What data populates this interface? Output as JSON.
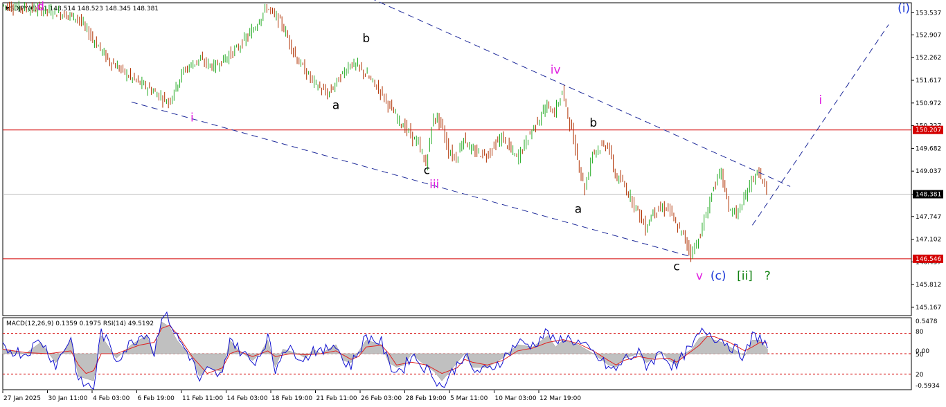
{
  "header": {
    "symbol_line": "USDJPY(€),H1  148.514 148.523 148.345 148.381",
    "indicator_line": "MACD(12,26,9) 0.1359 0.1975  RSI(14) 49.5192"
  },
  "chart_data": {
    "type": "line",
    "title": "USDJPY(€),H1",
    "ohlc_last": {
      "open": 148.514,
      "high": 148.523,
      "low": 148.345,
      "close": 148.381
    },
    "y_ticks": [
      "153.537",
      "152.907",
      "152.262",
      "151.617",
      "150.972",
      "150.327",
      "149.682",
      "149.037",
      "148.381",
      "147.747",
      "147.102",
      "146.457",
      "145.812",
      "145.167"
    ],
    "ylim": [
      144.95,
      153.8
    ],
    "x_ticks": [
      "27 Jan 2025",
      "30 Jan 11:00",
      "4 Feb 03:00",
      "6 Feb 19:00",
      "11 Feb 11:00",
      "14 Feb 03:00",
      "18 Feb 19:00",
      "21 Feb 11:00",
      "26 Feb 03:00",
      "28 Feb 19:00",
      "5 Mar 11:00",
      "10 Mar 03:00",
      "12 Mar 19:00"
    ],
    "price_path": [
      [
        0,
        153.75
      ],
      [
        6,
        153.6
      ],
      [
        10,
        153.4
      ],
      [
        14,
        152.2
      ],
      [
        17,
        151.7
      ],
      [
        20,
        151.3
      ],
      [
        22,
        151.0
      ],
      [
        24,
        151.9
      ],
      [
        26,
        152.2
      ],
      [
        28,
        152.0
      ],
      [
        31,
        152.5
      ],
      [
        33,
        153.0
      ],
      [
        35,
        153.7
      ],
      [
        37,
        153.2
      ],
      [
        39,
        152.2
      ],
      [
        41,
        151.6
      ],
      [
        43,
        151.2
      ],
      [
        44,
        151.5
      ],
      [
        46,
        152.1
      ],
      [
        47,
        152.0
      ],
      [
        48,
        151.8
      ],
      [
        50,
        151.3
      ],
      [
        52,
        150.6
      ],
      [
        55,
        149.8
      ],
      [
        56,
        149.2
      ],
      [
        57,
        150.6
      ],
      [
        58,
        150.4
      ],
      [
        59,
        149.6
      ],
      [
        60,
        149.4
      ],
      [
        61,
        150.0
      ],
      [
        62,
        149.6
      ],
      [
        64,
        149.5
      ],
      [
        66,
        150.0
      ],
      [
        68,
        149.4
      ],
      [
        70,
        150.2
      ],
      [
        72,
        150.9
      ],
      [
        73,
        150.7
      ],
      [
        74,
        151.3
      ],
      [
        75,
        150.4
      ],
      [
        76,
        149.4
      ],
      [
        77,
        148.5
      ],
      [
        78,
        149.6
      ],
      [
        80,
        149.8
      ],
      [
        81,
        148.9
      ],
      [
        82,
        148.7
      ],
      [
        84,
        147.9
      ],
      [
        85,
        147.4
      ],
      [
        86,
        147.9
      ],
      [
        88,
        148.0
      ],
      [
        89,
        147.5
      ],
      [
        90,
        147.2
      ],
      [
        91,
        146.7
      ],
      [
        92,
        147.1
      ],
      [
        93,
        147.8
      ],
      [
        94,
        148.6
      ],
      [
        95,
        149.0
      ],
      [
        96,
        148.0
      ],
      [
        97,
        147.8
      ],
      [
        98,
        148.2
      ],
      [
        99,
        148.8
      ],
      [
        100,
        149.0
      ],
      [
        101,
        148.4
      ]
    ],
    "macd_line": [
      [
        0,
        0.1
      ],
      [
        3,
        0.0
      ],
      [
        5,
        0.25
      ],
      [
        7,
        -0.2
      ],
      [
        9,
        0.3
      ],
      [
        10,
        -0.5
      ],
      [
        12,
        -0.6
      ],
      [
        13,
        0.4
      ],
      [
        15,
        -0.1
      ],
      [
        17,
        0.2
      ],
      [
        19,
        0.4
      ],
      [
        20,
        0.0
      ],
      [
        21,
        0.7
      ],
      [
        22,
        0.6
      ],
      [
        23,
        0.3
      ],
      [
        24,
        0.1
      ],
      [
        25,
        -0.1
      ],
      [
        26,
        -0.5
      ],
      [
        27,
        -0.3
      ],
      [
        29,
        -0.4
      ],
      [
        30,
        0.3
      ],
      [
        31,
        0.1
      ],
      [
        33,
        -0.15
      ],
      [
        34,
        0.0
      ],
      [
        35,
        0.3
      ],
      [
        36,
        -0.3
      ],
      [
        37,
        0.1
      ],
      [
        39,
        0.0
      ],
      [
        40,
        -0.1
      ],
      [
        41,
        0.1
      ],
      [
        42,
        0.0
      ],
      [
        44,
        0.2
      ],
      [
        45,
        -0.15
      ],
      [
        46,
        -0.2
      ],
      [
        47,
        0.05
      ],
      [
        48,
        0.3
      ],
      [
        50,
        0.2
      ],
      [
        51,
        -0.2
      ],
      [
        52,
        -0.3
      ],
      [
        53,
        -0.25
      ],
      [
        54,
        0.0
      ],
      [
        55,
        -0.15
      ],
      [
        57,
        -0.4
      ],
      [
        58,
        -0.6
      ],
      [
        60,
        -0.2
      ],
      [
        61,
        0.0
      ],
      [
        62,
        -0.3
      ],
      [
        64,
        -0.3
      ],
      [
        66,
        -0.1
      ],
      [
        68,
        0.2
      ],
      [
        70,
        0.15
      ],
      [
        72,
        0.4
      ],
      [
        73,
        0.15
      ],
      [
        74,
        0.3
      ],
      [
        76,
        0.2
      ],
      [
        77,
        0.1
      ],
      [
        78,
        0.0
      ],
      [
        80,
        -0.25
      ],
      [
        81,
        -0.3
      ],
      [
        82,
        -0.1
      ],
      [
        84,
        0.0
      ],
      [
        85,
        -0.2
      ],
      [
        86,
        -0.1
      ],
      [
        87,
        0.05
      ],
      [
        88,
        -0.15
      ],
      [
        89,
        -0.25
      ],
      [
        90,
        0.0
      ],
      [
        91,
        0.1
      ],
      [
        92,
        0.35
      ],
      [
        93,
        0.4
      ],
      [
        94,
        0.3
      ],
      [
        95,
        0.25
      ],
      [
        96,
        0.15
      ],
      [
        97,
        0.05
      ],
      [
        98,
        -0.05
      ],
      [
        99,
        0.3
      ],
      [
        100,
        0.3
      ],
      [
        101,
        0.1
      ]
    ],
    "signal_line": [
      [
        0,
        0.08
      ],
      [
        3,
        0.02
      ],
      [
        6,
        0.0
      ],
      [
        9,
        0.05
      ],
      [
        10,
        -0.2
      ],
      [
        11,
        -0.35
      ],
      [
        12,
        -0.3
      ],
      [
        13,
        0.0
      ],
      [
        15,
        0.0
      ],
      [
        18,
        0.15
      ],
      [
        20,
        0.2
      ],
      [
        21,
        0.45
      ],
      [
        22,
        0.5
      ],
      [
        23,
        0.35
      ],
      [
        24,
        0.15
      ],
      [
        25,
        -0.05
      ],
      [
        27,
        -0.35
      ],
      [
        29,
        -0.25
      ],
      [
        30,
        0.0
      ],
      [
        31,
        0.05
      ],
      [
        33,
        -0.05
      ],
      [
        35,
        0.05
      ],
      [
        36,
        -0.05
      ],
      [
        38,
        0.0
      ],
      [
        40,
        -0.02
      ],
      [
        42,
        0.0
      ],
      [
        44,
        0.05
      ],
      [
        46,
        -0.1
      ],
      [
        47,
        -0.05
      ],
      [
        48,
        0.12
      ],
      [
        50,
        0.15
      ],
      [
        51,
        0.0
      ],
      [
        52,
        -0.2
      ],
      [
        54,
        -0.15
      ],
      [
        56,
        -0.2
      ],
      [
        58,
        -0.35
      ],
      [
        60,
        -0.25
      ],
      [
        61,
        -0.1
      ],
      [
        62,
        -0.15
      ],
      [
        64,
        -0.2
      ],
      [
        66,
        -0.12
      ],
      [
        68,
        0.05
      ],
      [
        70,
        0.1
      ],
      [
        72,
        0.2
      ],
      [
        74,
        0.25
      ],
      [
        76,
        0.18
      ],
      [
        78,
        0.05
      ],
      [
        80,
        -0.12
      ],
      [
        81,
        -0.2
      ],
      [
        82,
        -0.12
      ],
      [
        84,
        -0.05
      ],
      [
        86,
        -0.1
      ],
      [
        88,
        -0.08
      ],
      [
        89,
        -0.15
      ],
      [
        90,
        -0.05
      ],
      [
        92,
        0.15
      ],
      [
        93,
        0.3
      ],
      [
        94,
        0.3
      ],
      [
        96,
        0.2
      ],
      [
        98,
        0.05
      ],
      [
        99,
        0.12
      ],
      [
        100,
        0.2
      ],
      [
        101,
        0.19
      ]
    ],
    "sub_ticks": [
      "0.5478",
      "80",
      "0.00",
      "50",
      "20",
      "-0.5934"
    ],
    "hlines": [
      {
        "label": "150.207",
        "price": 150.207,
        "color": "#d40000"
      },
      {
        "label": "146.546",
        "price": 146.546,
        "color": "#d40000"
      },
      {
        "label": "148.381",
        "price": 148.381,
        "color": "#bbbbbb"
      }
    ],
    "channel_lines": [
      {
        "from": [
          17,
          151.0
        ],
        "to": [
          91,
          146.6
        ]
      },
      {
        "from": [
          46,
          154.2
        ],
        "to": [
          104,
          148.6
        ]
      }
    ],
    "projection_line": {
      "from": [
        99,
        147.5
      ],
      "to": [
        117,
        153.2
      ]
    },
    "annotations": [
      {
        "text": "d",
        "x": 5,
        "y": 153.6,
        "color": "#e020e0"
      },
      {
        "text": "b",
        "x": 48,
        "y": 152.7,
        "color": "#000000"
      },
      {
        "text": "a",
        "x": 44,
        "y": 150.8,
        "color": "#000000"
      },
      {
        "text": "i",
        "x": 25,
        "y": 150.45,
        "color": "#e020e0"
      },
      {
        "text": "iv",
        "x": 73,
        "y": 151.8,
        "color": "#e020e0"
      },
      {
        "text": "b",
        "x": 78,
        "y": 150.3,
        "color": "#000000"
      },
      {
        "text": "c",
        "x": 56,
        "y": 148.95,
        "color": "#000000"
      },
      {
        "text": "iii",
        "x": 57,
        "y": 148.55,
        "color": "#e020e0"
      },
      {
        "text": "a",
        "x": 76,
        "y": 147.85,
        "color": "#000000"
      },
      {
        "text": "c",
        "x": 89,
        "y": 146.22,
        "color": "#000000"
      },
      {
        "text": "v",
        "x": 92,
        "y": 145.95,
        "color": "#e020e0"
      },
      {
        "text": "(c)",
        "x": 94.5,
        "y": 145.95,
        "color": "#1e3ad8"
      },
      {
        "text": "[ii]",
        "x": 98,
        "y": 145.95,
        "color": "#108010"
      },
      {
        "text": "?",
        "x": 101,
        "y": 145.95,
        "color": "#108010"
      },
      {
        "text": "i",
        "x": 108,
        "y": 150.95,
        "color": "#e020e0"
      },
      {
        "text": "(i)",
        "x": 119,
        "y": 153.55,
        "color": "#1e3ad8"
      }
    ]
  }
}
